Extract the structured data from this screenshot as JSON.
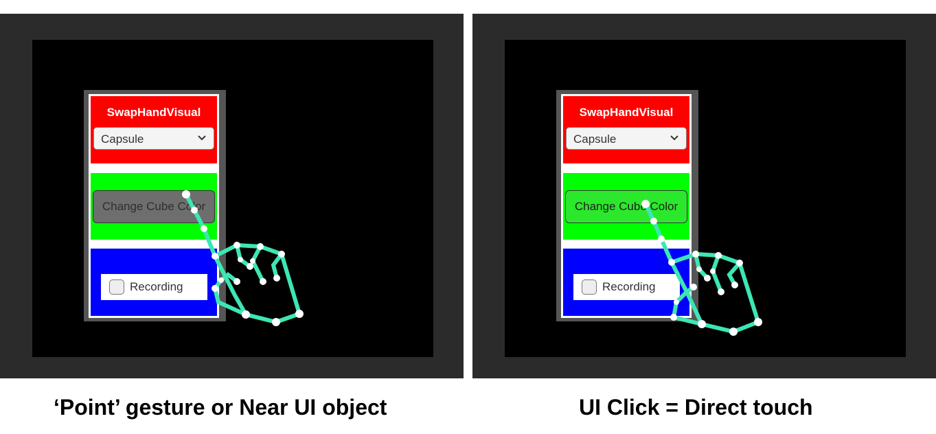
{
  "panels": [
    {
      "panel_title": "SwapHandVisual",
      "dropdown_value": "Capsule",
      "button_label": "Change Cube Color",
      "button_state": "pointed",
      "checkbox_label": "Recording",
      "caption": "‘Point’ gesture or Near UI object"
    },
    {
      "panel_title": "SwapHandVisual",
      "dropdown_value": "Capsule",
      "button_label": "Change Cube Color",
      "button_state": "pressed",
      "checkbox_label": "Recording",
      "caption": "UI Click = Direct touch"
    }
  ],
  "colors": {
    "frame": "#2b2b2b",
    "screen": "#000000",
    "red_section": "#ff0000",
    "green_section": "#00ff00",
    "blue_section": "#0000ff",
    "button_pointed": "#6e6e6e",
    "button_pressed": "#2ce82c",
    "hand_bones": "#3de6b4",
    "hand_joints": "#ffffff"
  },
  "icons": [
    "chevron-down-icon",
    "checkbox-icon",
    "hand-skeleton-icon"
  ]
}
